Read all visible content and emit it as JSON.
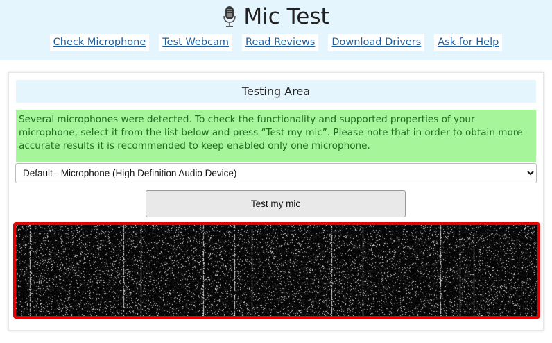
{
  "header": {
    "title": "Mic Test",
    "nav": [
      {
        "label": "Check Microphone"
      },
      {
        "label": "Test Webcam"
      },
      {
        "label": "Read Reviews"
      },
      {
        "label": "Download Drivers"
      },
      {
        "label": "Ask for Help"
      }
    ]
  },
  "testing_area": {
    "title": "Testing Area",
    "notice": "Several microphones were detected. To check the functionality and supported properties of your microphone, select it from the list below and press “Test my mic”. Please note that in order to obtain more accurate results it is recommended to keep enabled only one microphone.",
    "device_select": {
      "selected": "Default - Microphone (High Definition Audio Device)"
    },
    "test_button_label": "Test my mic"
  },
  "colors": {
    "header_bg": "#e4f5fd",
    "link": "#1f5f9e",
    "notice_bg": "#a6f59a",
    "notice_text": "#1f6b1f",
    "visualizer_border": "#e60000",
    "visualizer_bg": "#070707"
  },
  "icons": {
    "title_icon": "microphone-icon",
    "select_caret": "chevron-down-icon"
  }
}
